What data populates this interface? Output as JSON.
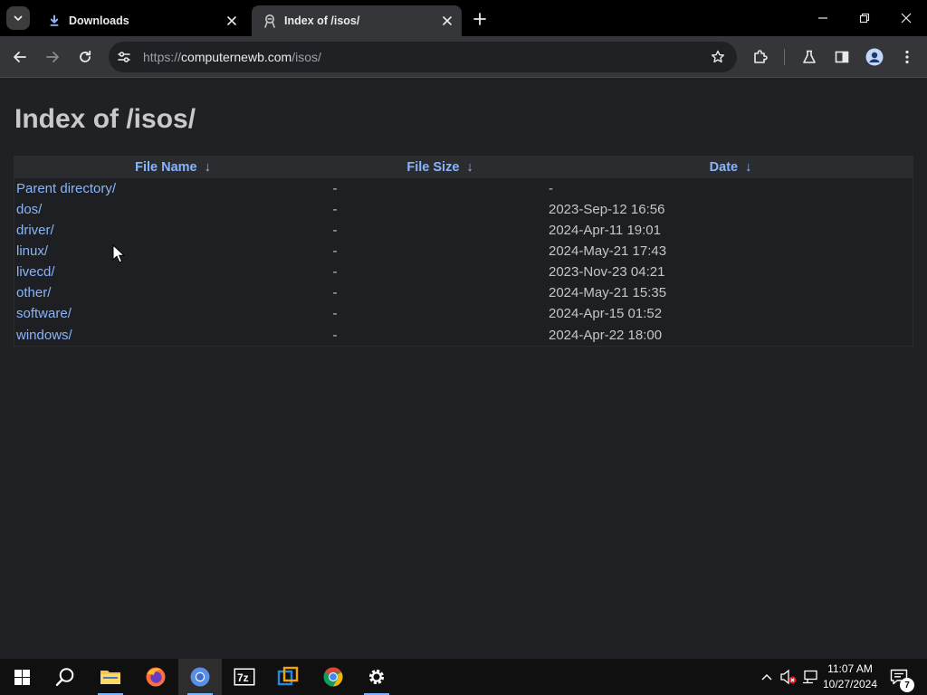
{
  "browser": {
    "tabs": [
      {
        "title": "Downloads",
        "active": false
      },
      {
        "title": "Index of /isos/",
        "active": true
      }
    ],
    "url": {
      "scheme": "https://",
      "host": "computernewb.com",
      "path": "/isos/"
    }
  },
  "page": {
    "heading": "Index of /isos/",
    "columns": [
      {
        "label": "File Name",
        "sort": "↓"
      },
      {
        "label": "File Size",
        "sort": "↓"
      },
      {
        "label": "Date",
        "sort": "↓"
      }
    ],
    "rows": [
      {
        "name": "Parent directory/",
        "size": "-",
        "date": "-"
      },
      {
        "name": "dos/",
        "size": "-",
        "date": "2023-Sep-12 16:56"
      },
      {
        "name": "driver/",
        "size": "-",
        "date": "2024-Apr-11 19:01"
      },
      {
        "name": "linux/",
        "size": "-",
        "date": "2024-May-21 17:43"
      },
      {
        "name": "livecd/",
        "size": "-",
        "date": "2023-Nov-23 04:21"
      },
      {
        "name": "other/",
        "size": "-",
        "date": "2024-May-21 15:35"
      },
      {
        "name": "software/",
        "size": "-",
        "date": "2024-Apr-15 01:52"
      },
      {
        "name": "windows/",
        "size": "-",
        "date": "2024-Apr-22 18:00"
      }
    ]
  },
  "taskbar": {
    "apps": [
      "start-icon",
      "search-icon",
      "file-explorer-icon",
      "firefox-icon",
      "chromium-icon",
      "7zip-icon",
      "virtualbox-icon",
      "chrome-icon",
      "settings-icon"
    ],
    "clock": {
      "time": "11:07 AM",
      "date": "10/27/2024"
    },
    "notification_count": "7"
  },
  "colors": {
    "link": "#8ab4f8",
    "page_bg": "#202124",
    "heading": "#c9c9c9"
  }
}
